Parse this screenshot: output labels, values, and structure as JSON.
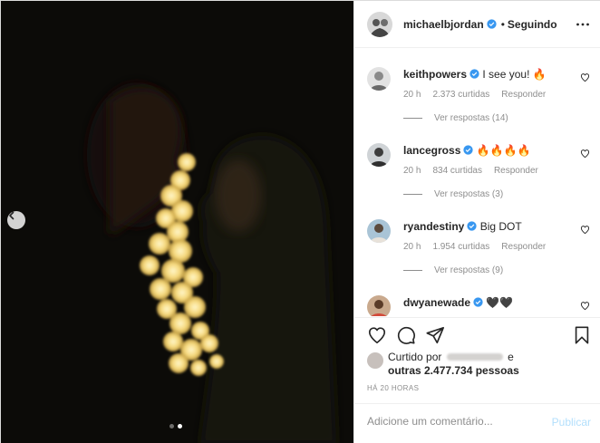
{
  "post": {
    "author": "michaelbjordan",
    "separator": "•",
    "follow_status": "Seguindo",
    "author_verified": true
  },
  "comments": [
    {
      "user": "keithpowers",
      "verified": true,
      "text": "I see you! 🔥",
      "time": "20 h",
      "likes": "2.373 curtidas",
      "reply": "Responder",
      "replies": "Ver respostas (14)"
    },
    {
      "user": "lancegross",
      "verified": true,
      "text": "🔥🔥🔥🔥",
      "time": "20 h",
      "likes": "834 curtidas",
      "reply": "Responder",
      "replies": "Ver respostas (3)"
    },
    {
      "user": "ryandestiny",
      "verified": true,
      "text": "Big DOT",
      "time": "20 h",
      "likes": "1.954 curtidas",
      "reply": "Responder",
      "replies": "Ver respostas (9)"
    },
    {
      "user": "dwyanewade",
      "verified": true,
      "text": "🖤🖤"
    }
  ],
  "likes": {
    "prefix": "Curtido por",
    "conjunction": "e",
    "others": "outras 2.477.734 pessoas"
  },
  "timestamp": "HÁ 20 HORAS",
  "composer": {
    "placeholder": "Adicione um comentário...",
    "publish": "Publicar"
  },
  "carousel": {
    "total": 2,
    "current": 2
  },
  "icons": {
    "prev": "chevron-left-icon",
    "more": "more-options-icon",
    "like": "heart-icon",
    "comment": "comment-icon",
    "share": "paper-plane-icon",
    "save": "bookmark-icon"
  },
  "colors": {
    "verified": "#3897f0",
    "publish_disabled": "#b2dffc",
    "muted": "#8e8e8e"
  }
}
